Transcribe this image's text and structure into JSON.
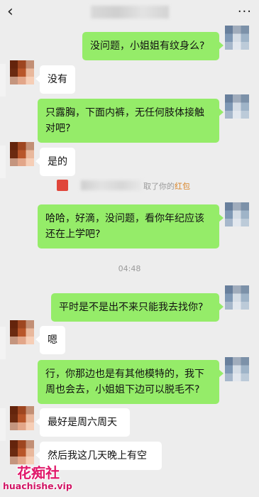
{
  "header": {
    "back_icon": "chevron-left-icon",
    "more_icon": "more-dots-icon",
    "more_glyph": "···"
  },
  "messages": [
    {
      "side": "right",
      "text": "没问题，小姐姐有纹身么?"
    },
    {
      "side": "left",
      "text": "没有"
    },
    {
      "side": "right",
      "text": "只露胸，下面内裤，无任何肢体接触对吧?"
    },
    {
      "side": "left",
      "text": "是的"
    },
    {
      "side": "right",
      "text": "哈哈，好滴，没问题，看你年纪应该还在上学吧?"
    },
    {
      "side": "right",
      "text": "平时是不是出不来只能我去找你?"
    },
    {
      "side": "left",
      "text": "嗯"
    },
    {
      "side": "right",
      "text": "行，你那边也是有其他模特的，我下周也会去，小姐姐下边可以脱毛不?"
    },
    {
      "side": "left",
      "text": "最好是周六周天"
    },
    {
      "side": "left",
      "text": "然后我这几天晚上有空"
    }
  ],
  "system_notice": {
    "text": "取了你的",
    "link": "红包",
    "icon": "red-packet-icon"
  },
  "timestamp": "04:48",
  "colors": {
    "background": "#ededed",
    "sent_bubble": "#95ec69",
    "received_bubble": "#ffffff",
    "link": "#d9852a"
  },
  "watermark": {
    "cn": "花痴社",
    "en": "huachishe.vip"
  }
}
